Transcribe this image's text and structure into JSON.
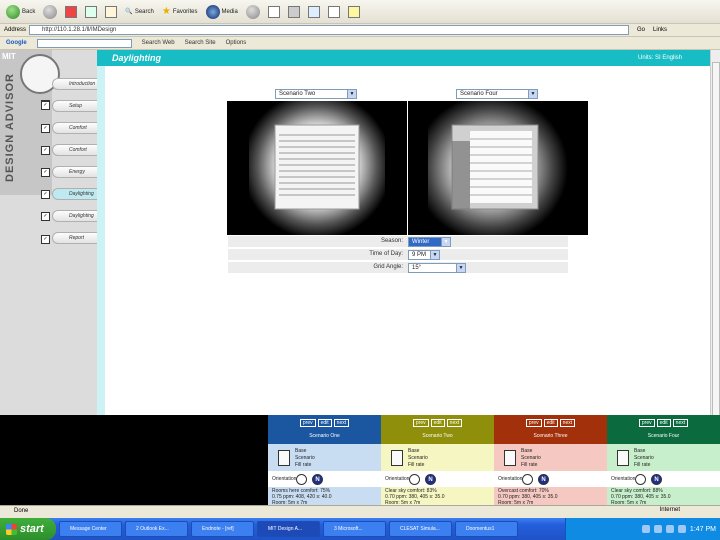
{
  "browser": {
    "back_label": "Back",
    "search_label": "Search",
    "favorites_label": "Favorites",
    "media_label": "Media",
    "address_label": "Address",
    "address_value": "http://110.1.28.1/ll/IMDesign",
    "go_label": "Go",
    "links_label": "Links",
    "google_label": "Google",
    "google_items": [
      "Search Web",
      "Search Site",
      "Options"
    ]
  },
  "sidebar": {
    "vertical_title": "DESIGN ADVISOR",
    "logo_text": "MIT",
    "nav": [
      {
        "label": "Introduction",
        "checked": false
      },
      {
        "label": "Setup",
        "checked": true
      },
      {
        "label": "Comfort",
        "checked": true
      },
      {
        "label": "Comfort",
        "checked": true
      },
      {
        "label": "Energy",
        "checked": true
      },
      {
        "label": "Daylighting",
        "checked": true,
        "active": true
      },
      {
        "label": "Daylighting",
        "checked": true
      },
      {
        "label": "Report",
        "checked": true
      }
    ]
  },
  "header": {
    "title": "Daylighting",
    "units": "Units: SI  English"
  },
  "main": {
    "scenario_left": "Scenario Two",
    "scenario_right": "Scenario Four",
    "season_label": "Season:",
    "season_value": "Winter",
    "time_label": "Time of Day:",
    "time_value": "9 PM",
    "grid_label": "Grid Angle:",
    "grid_value": "15°"
  },
  "panels": [
    {
      "color": "#1a57a0",
      "light": "#c9ddf2",
      "b1": "prev",
      "b2": "edit",
      "b3": "next",
      "sub": "Scenario One",
      "l1": "Base",
      "l2": "Scenario",
      "l3": "Fill rate",
      "orient": "Orientation",
      "l4": "Rooms here   comfort: 75%",
      "l5": "0.75 ppm:  408, 420 s: 40.0",
      "l6": "Room: 5m x 7m"
    },
    {
      "color": "#8f8f0b",
      "light": "#f6f6c3",
      "b1": "prev",
      "b2": "edit",
      "b3": "next",
      "sub": "Scenario Two",
      "l1": "Base",
      "l2": "Scenario",
      "l3": "Fill rate",
      "orient": "Orientation",
      "l4": "Clear sky   comfort: 83%",
      "l5": "0.70 ppm: 380, 405 s: 35.0",
      "l6": "Room: 5m x 7m"
    },
    {
      "color": "#a2300b",
      "light": "#f5c9c2",
      "b1": "prev",
      "b2": "edit",
      "b3": "next",
      "sub": "Scenario Three",
      "l1": "Base",
      "l2": "Scenario",
      "l3": "Fill rate",
      "orient": "Orientation",
      "l4": "Overcast   comfort: 70%",
      "l5": "0.70 ppm: 380, 405 s: 35.0",
      "l6": "Room: 5m x 7m"
    },
    {
      "color": "#0b6b3f",
      "light": "#c8efcb",
      "b1": "prev",
      "b2": "edit",
      "b3": "next",
      "sub": "Scenario Four",
      "l1": "Base",
      "l2": "Scenario",
      "l3": "Fill rate",
      "orient": "Orientation",
      "l4": "Clear sky   comfort: 88%",
      "l5": "0.70 ppm: 380, 405 s: 35.0",
      "l6": "Room: 5m x 7m"
    }
  ],
  "status": {
    "left": "Done",
    "right": "Internet"
  },
  "taskbar": {
    "start_label": "start",
    "tasks": [
      "Message Center",
      "2 Outlook Ex...",
      "Endnote - [ref]",
      "MIT Design A...",
      "3 Microsoft...",
      "CLESAT Simula...",
      "Doomentus1"
    ],
    "clock": "1:47 PM"
  }
}
